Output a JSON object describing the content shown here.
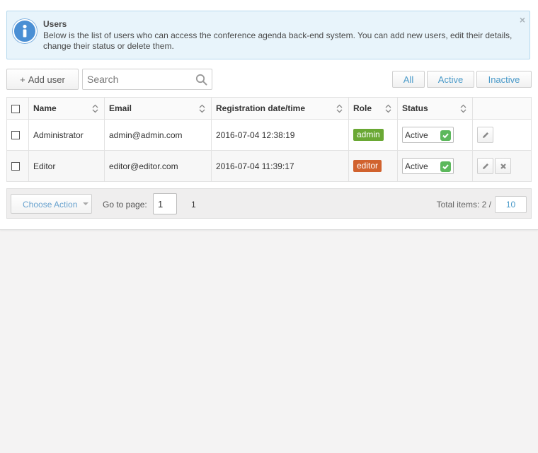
{
  "alert": {
    "title": "Users",
    "text": "Below is the list of users who can access the conference agenda back-end system. You can add new users, edit their details, change their status or delete them.",
    "close": "×"
  },
  "toolbar": {
    "add_plus": "+",
    "add_label": "Add user",
    "search_placeholder": "Search",
    "filters": [
      "All",
      "Active",
      "Inactive"
    ]
  },
  "table": {
    "headers": [
      "Name",
      "Email",
      "Registration date/time",
      "Role",
      "Status"
    ],
    "rows": [
      {
        "name": "Administrator",
        "email": "admin@admin.com",
        "registered": "2016-07-04 12:38:19",
        "role": "admin",
        "role_color": "#6aa834",
        "status": "Active"
      },
      {
        "name": "Editor",
        "email": "editor@editor.com",
        "registered": "2016-07-04 11:39:17",
        "role": "editor",
        "role_color": "#d1622e",
        "status": "Active"
      }
    ]
  },
  "footer": {
    "choose_action": "Choose Action",
    "goto_label": "Go to page:",
    "page_value": "1",
    "page_number": "1",
    "total_label": "Total items: 2 /",
    "per_page": "10"
  },
  "colors": {
    "accent": "#4a9ac9",
    "active_check": "#5cb85c"
  }
}
